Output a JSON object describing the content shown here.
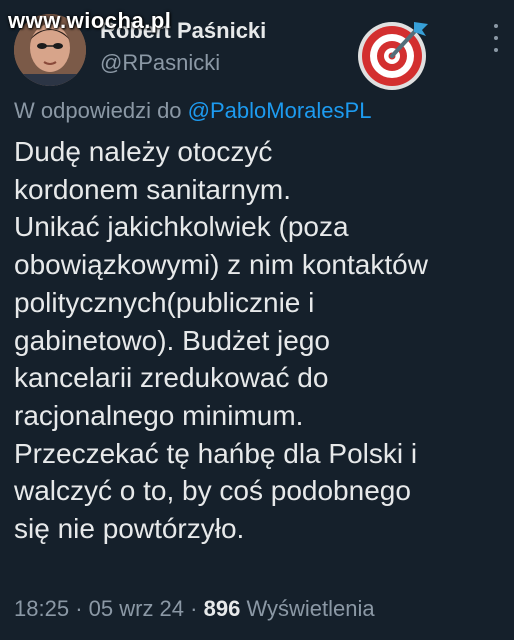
{
  "watermark": "www.wiocha.pl",
  "author": {
    "display_name": "Robert Paśnicki",
    "handle": "@RPasnicki",
    "badge_emoji": "direct-hit-target-icon"
  },
  "reply": {
    "prefix": "W odpowiedzi do",
    "to": "@PabloMoralesPL"
  },
  "body_lines": [
    "Dudę należy otoczyć",
    "kordonem sanitarnym.",
    "Unikać jakichkolwiek (poza",
    "obowiązkowymi) z nim kontaktów",
    "politycznych(publicznie i",
    "gabinetowo). Budżet jego",
    "kancelarii zredukować do",
    "racjonalnego minimum.",
    "Przeczekać tę hańbę dla Polski i",
    "walczyć o to, by coś podobnego",
    "się nie powtórzyło."
  ],
  "meta": {
    "time": "18:25",
    "date": "05 wrz 24",
    "sep": "·",
    "views_count": "896",
    "views_label": "Wyświetlenia"
  },
  "colors": {
    "background": "#15202b",
    "text_primary": "#e7e9ea",
    "text_secondary": "#8b98a5",
    "link": "#1d9bf0"
  }
}
